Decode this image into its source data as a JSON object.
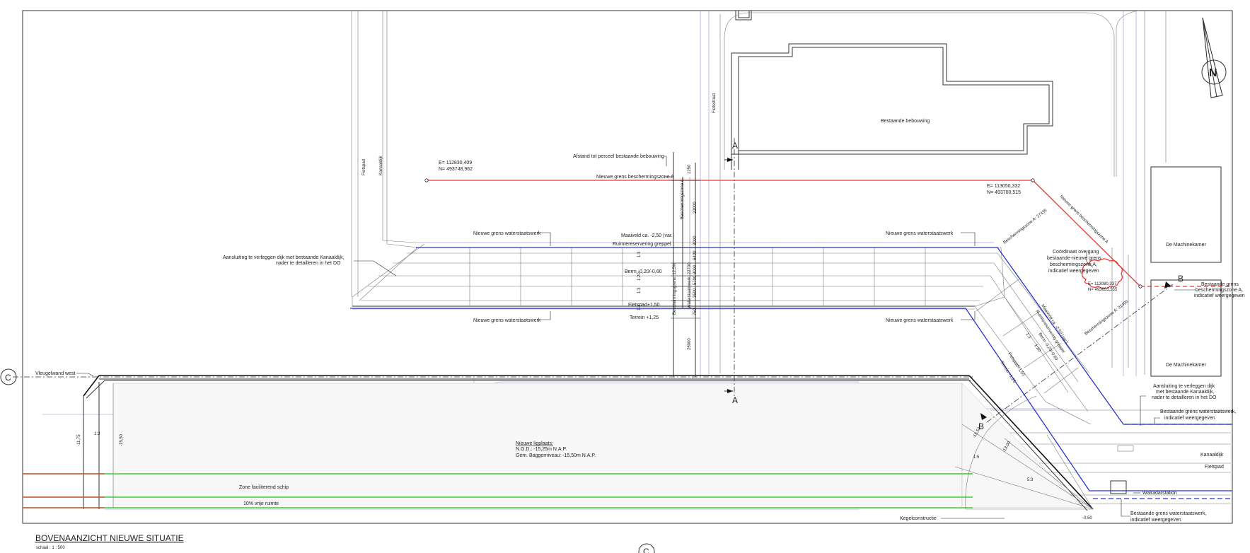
{
  "title": {
    "main": "BOVENAANZICHT NIEUWE SITUATIE",
    "scale": "schaal : 1 : 500"
  },
  "section_markers": {
    "a_top": "A",
    "a_bottom": "A",
    "b_left": "B",
    "b_right": "B",
    "c_left": "C",
    "c_bottom": "C"
  },
  "north": "N",
  "labels": {
    "bestaande_bebouwing": "Bestaande bebouwing",
    "machinekamer_1": "De Machinekamer",
    "machinekamer_2": "De Machinekamer",
    "afstand": "Afstand tot perceel bestaande bebouwing",
    "grens_bz_a": "Nieuwe grens beschermingszone A",
    "grens_bz_a_diag": "Nieuwe grens beschermingszone A",
    "coord_left_e": "E= 112830,409",
    "coord_left_n": "N= 493748,962",
    "coord_right_e": "E= 113050,332",
    "coord_right_n": "N= 493700,515",
    "coord_cloud_e": "E= 113080,337",
    "coord_cloud_n": "N= 493653,555",
    "fietspad_v": "Fietspad",
    "kanaaldijk_v": "Kanaaldijk",
    "fietsstraat": "Fietsstraat",
    "ws_top_left": "Nieuwe grens waterstaatswerk",
    "ws_top_right": "Nieuwe grens waterstaatswerk",
    "ws_bot_left": "Nieuwe grens waterstaatswerk",
    "ws_bot_right": "Nieuwe grens waterstaatswerk",
    "maaiveld": "Maaiveld ca. -2,50 (var.)",
    "maaiveld_diag": "Maaiveld ca. -2,50 (var.)",
    "ruimte": "Ruimtereservering greppel",
    "ruimte_diag": "Ruimtereservering greppel",
    "berm": "Berm -0,20/-0,60",
    "berm_diag": "Berm -0,20/-0,60",
    "fietspad": "Fietspad+1,50",
    "fietspad_diag": "Fietspad+1,50",
    "terrein": "Terrein +1,25",
    "terrein_diag": "Terrein +1,25",
    "aansluiting_1": "Aansluiting te verleggen dijk met bestaande Kanaaldijk,",
    "aansluiting_2": "nader te detailleren in het DO",
    "coord_overgang_1": "Coördinaat overgang",
    "coord_overgang_2": "bestaande-nieuwe grens",
    "coord_overgang_3": "beschermingszone A,",
    "coord_overgang_4": "indicatief weergegeven",
    "bestaande_grens_1": "Bestaande grens",
    "bestaande_grens_2": "beschermingszone A,",
    "bestaande_grens_3": "indicatief weergegeven",
    "bz_diag_1": "Beschermingszone A: 27435",
    "bz_diag_2": "Beschermingszone A: 31400",
    "bz_vert": "Beschermingszone A:",
    "beschermingsgrens": "Beschermingsgrens: 12,5%",
    "waterstaatswerk_vert": "Waterstaatswerk: 22700",
    "vleugelwand": "Vleugelwand west",
    "aansl_r_1": "Aansluiting te verleggen dijk",
    "aansl_r_2": "met bestaande Kanaaldijk,",
    "aansl_r_3": "nader te detailleren in het DO",
    "bws_1": "Bestaande grens waterstaatswerk,",
    "bws_2": "indicatief weergegeven",
    "kanaaldijk_r": "Kanaaldijk",
    "fietspad_r": "Fietspad",
    "walradar": "Walradarstation",
    "bws_b_1": "Bestaande grens waterstaatswerk,",
    "bws_b_2": "indicatief weergegeven",
    "kegel": "Kegelconstructie",
    "ligplaats_1": "Nieuwe ligplaats:",
    "ligplaats_2": "N.G.D.: -15,25m N.A.P.",
    "ligplaats_3": "Gem. Baggerniveau: -15,50m N.A.P.",
    "zone": "Zone faciliterend schip",
    "vrije": "10% vrije ruimte",
    "lvl_1175": "-11,75",
    "lvl_1550": "-15,50",
    "lvl_1550b": "-15,50",
    "lvl_1300": "-13,00",
    "lvl_050": "-0,50",
    "slope_13": "1:3",
    "slope_13b": "1:3",
    "slope_13c": "1:3",
    "slope_13d": "1:3",
    "slope_15": "1:5",
    "slope_53": "5:3",
    "slope_120": "1:20",
    "slope_120b": "1:20",
    "dim_1250": "1250",
    "dim_22000": "22000",
    "dim_3000": "3000",
    "dim_6400": "6400",
    "dim_8000": "8000",
    "dim_5700": "5700",
    "dim_3500": "3500",
    "dim_750": "750",
    "dim_25000": "25000"
  }
}
